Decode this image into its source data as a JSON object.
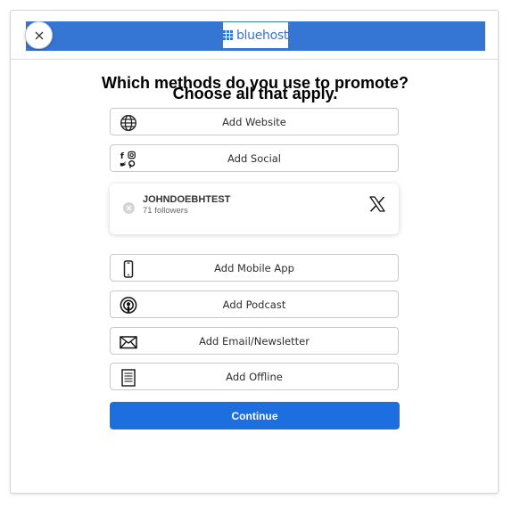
{
  "header": {
    "logo_text": "bluehost",
    "brand_color": "#3575d3",
    "close_icon": "close-icon"
  },
  "title": "Which methods do you use to promote? Choose all that apply.",
  "options": [
    {
      "label": "Add Website",
      "icon": "globe-icon"
    },
    {
      "label": "Add Social",
      "icon": "social-icons"
    },
    {
      "label": "Add Mobile App",
      "icon": "mobile-phone-icon"
    },
    {
      "label": "Add Podcast",
      "icon": "podcast-icon"
    },
    {
      "label": "Add Email/Newsletter",
      "icon": "envelope-icon"
    },
    {
      "label": "Add Offline",
      "icon": "document-icon"
    }
  ],
  "social_account": {
    "handle": "JOHNDOEBHTEST",
    "followers": "71 followers",
    "network_icon": "x-logo-icon"
  },
  "continue_label": "Continue",
  "continue_color": "#1d6fe0"
}
